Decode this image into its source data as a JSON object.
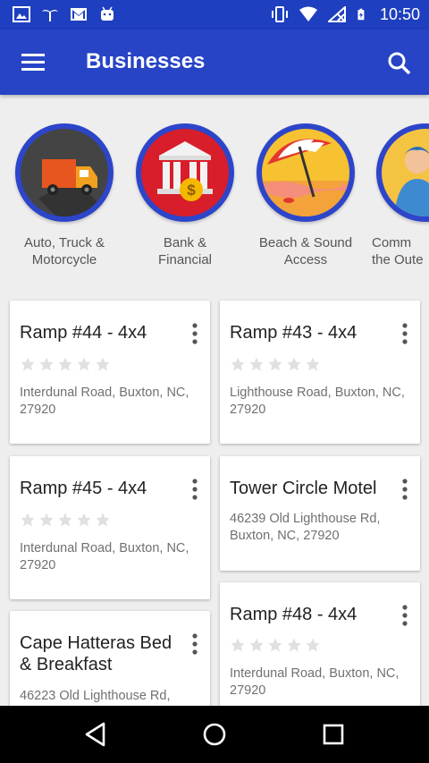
{
  "status_bar": {
    "time": "10:50",
    "left_icons": [
      "image-icon",
      "palm-tree-icon",
      "gmail-icon",
      "android-icon"
    ],
    "right_icons": [
      "vibrate-icon",
      "wifi-icon",
      "no-signal-icon",
      "battery-charging-icon"
    ]
  },
  "app_bar": {
    "title": "Businesses",
    "menu_icon": "hamburger-menu-icon",
    "search_icon": "search-icon",
    "color": "#2744C6"
  },
  "categories": [
    {
      "label": "Auto, Truck &\nMotorcycle",
      "icon": "truck-icon"
    },
    {
      "label": "Bank &\nFinancial",
      "icon": "bank-icon"
    },
    {
      "label": "Beach & Sound\nAccess",
      "icon": "beach-umbrella-icon"
    },
    {
      "label": "Comm\nthe Oute",
      "icon": "people-icon"
    }
  ],
  "cards": [
    {
      "title": "Ramp #44 - 4x4",
      "rating": 0,
      "address": "Interdunal Road, Buxton, NC, 27920"
    },
    {
      "title": "Ramp #43 - 4x4",
      "rating": 0,
      "address": "Lighthouse Road, Buxton, NC, 27920"
    },
    {
      "title": "Ramp #45 - 4x4",
      "rating": 0,
      "address": "Interdunal Road, Buxton, NC, 27920"
    },
    {
      "title": "Tower Circle Motel",
      "address": "46239 Old Lighthouse Rd, Buxton, NC, 27920"
    },
    {
      "title": "Ramp #48 - 4x4",
      "rating": 0,
      "address": "Interdunal Road, Buxton, NC, 27920"
    },
    {
      "title": "Cape Hatteras Bed & Breakfast",
      "address": "46223 Old Lighthouse Rd,"
    }
  ],
  "nav_bar": {
    "buttons": [
      "back-icon",
      "home-icon",
      "recents-icon"
    ]
  }
}
